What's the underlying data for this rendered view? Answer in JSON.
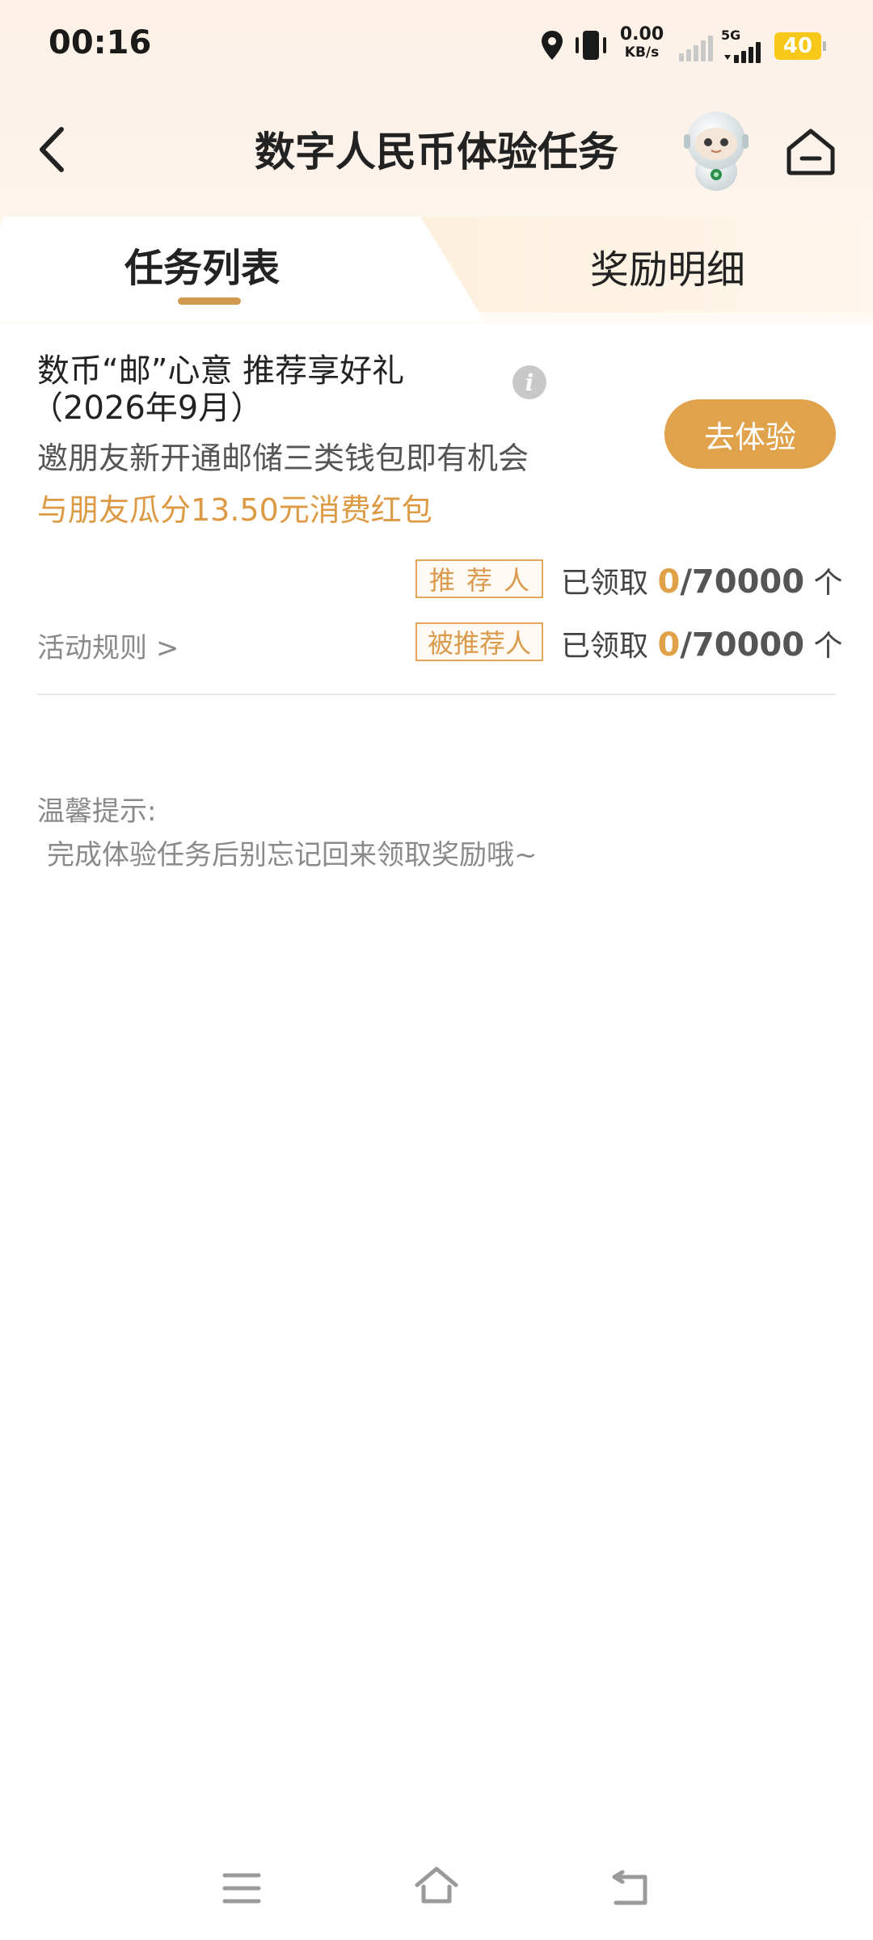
{
  "status_bar": {
    "time": "00:16",
    "net_speed_value": "0.00",
    "net_speed_unit": "KB/s",
    "network_type": "5G",
    "battery_level": "40",
    "battery_color": "#f7c71a"
  },
  "header": {
    "title": "数字人民币体验任务"
  },
  "tabs": [
    {
      "label": "任务列表",
      "active": true
    },
    {
      "label": "奖励明细",
      "active": false
    }
  ],
  "task": {
    "title_line1": "数币“邮”心意 推荐享好礼",
    "title_line2": "（2026年9月）",
    "info_icon_text": "i",
    "description": "邀朋友新开通邮储三类钱包即有机会",
    "reward_text": "与朋友瓜分13.50元消费红包",
    "cta_label": "去体验",
    "rules_label": "活动规则",
    "rules_arrow": ">",
    "roles": [
      {
        "badge": "推荐人",
        "claimed_label": "已领取",
        "claimed": "0",
        "separator": "/",
        "total": "70000",
        "unit": "个"
      },
      {
        "badge": "被推荐人",
        "claimed_label": "已领取",
        "claimed": "0",
        "separator": "/",
        "total": "70000",
        "unit": "个"
      }
    ]
  },
  "tips": {
    "title": "温馨提示:",
    "text": "完成体验任务后别忘记回来领取奖励哦~"
  },
  "colors": {
    "accent": "#e1a24c",
    "accent_text": "#dd9a45",
    "header_bg": "#fdf1e8"
  }
}
